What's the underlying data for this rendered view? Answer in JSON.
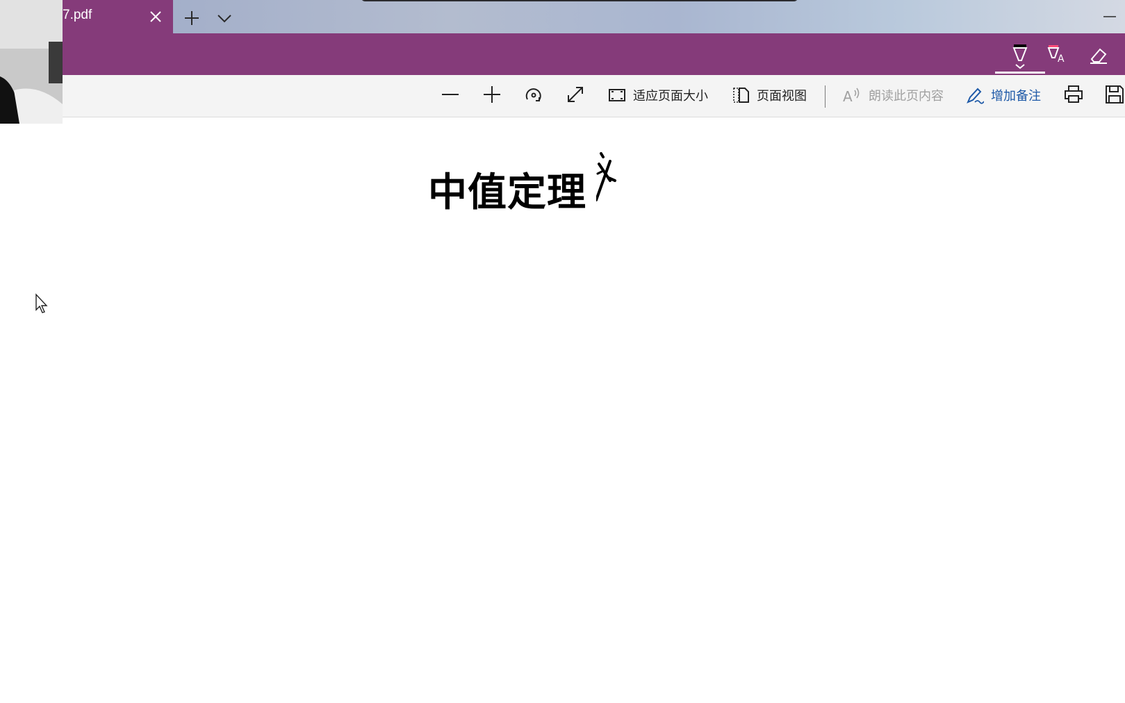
{
  "window": {
    "tab_title": "7.pdf"
  },
  "toolbar": {
    "zoom_out_label": "zoom out",
    "zoom_in_label": "zoom in",
    "fit_page_label": "适应页面大小",
    "page_view_label": "页面视图",
    "read_aloud_label": "朗读此页内容",
    "add_note_label": "增加备注"
  },
  "ink_toolbar": {
    "tools": [
      "pen-icon",
      "highlighter-icon",
      "eraser-icon"
    ]
  },
  "document": {
    "title": "中值定理"
  },
  "colors": {
    "brand": "#853b7a",
    "toolbar_bg": "#f4f4f4",
    "accent": "#1f5aa8",
    "disabled": "#a0a0a0"
  }
}
